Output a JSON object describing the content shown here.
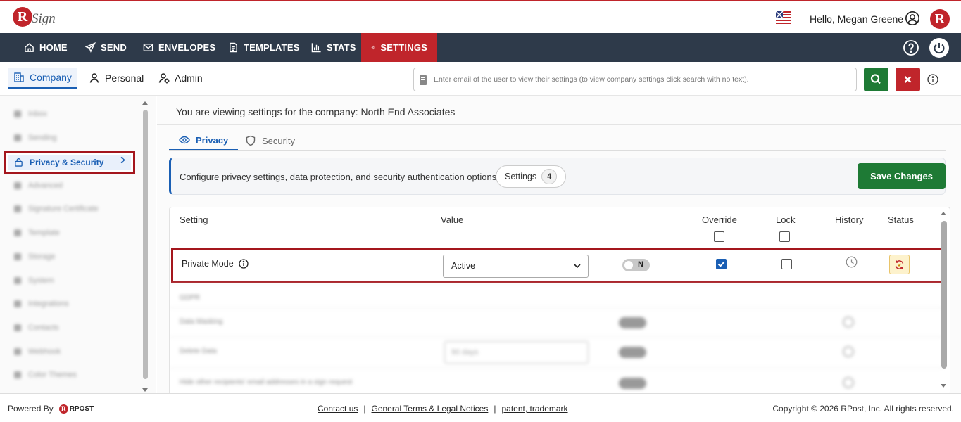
{
  "header": {
    "logo_letter": "R",
    "logo_text": "Sign",
    "greeting": "Hello, Megan Greene",
    "avatar_letter": "R",
    "flag_icon": "us-uk-flag-icon"
  },
  "nav": {
    "items": [
      {
        "label": "HOME",
        "icon": "home-icon"
      },
      {
        "label": "SEND",
        "icon": "send-icon"
      },
      {
        "label": "ENVELOPES",
        "icon": "envelope-icon"
      },
      {
        "label": "TEMPLATES",
        "icon": "template-icon"
      },
      {
        "label": "STATS",
        "icon": "stats-icon"
      },
      {
        "label": "SETTINGS",
        "icon": "gear-icon",
        "active": true
      }
    ],
    "active_color": "#c0252b",
    "bar_color": "#2e3a4a"
  },
  "subnav": {
    "tabs": [
      {
        "label": "Company",
        "active": true
      },
      {
        "label": "Personal"
      },
      {
        "label": "Admin"
      }
    ],
    "search_placeholder": "Enter email of the user to view their settings (to view company settings click search with no text)."
  },
  "sidebar": {
    "active_item": "Privacy & Security",
    "blurred_items": [
      "Inbox",
      "Sending",
      "Advanced",
      "Signature Certificate",
      "Template",
      "Storage",
      "System",
      "Integrations",
      "Contacts",
      "Webhook",
      "Color Themes"
    ]
  },
  "main": {
    "viewing_text": "You are viewing settings for the company: North End Associates",
    "tabs": [
      {
        "label": "Privacy",
        "active": true
      },
      {
        "label": "Security"
      }
    ],
    "info_text": "Configure privacy settings, data protection, and security authentication options.",
    "settings_pill_label": "Settings",
    "settings_count": "4",
    "save_label": "Save Changes"
  },
  "table": {
    "headers": {
      "setting": "Setting",
      "value": "Value",
      "override": "Override",
      "lock": "Lock",
      "history": "History",
      "status": "Status"
    },
    "highlighted_row": {
      "label": "Private Mode",
      "value": "Active",
      "toggle_label": "N",
      "override_checked": true,
      "lock_checked": false
    },
    "blurred_rows": [
      "GDPR",
      "Data Masking",
      "Delete Data",
      "Hide other recipients' email addresses in a sign request"
    ],
    "blurred_select_value": "90 days"
  },
  "footer": {
    "powered_by": "Powered By",
    "brand": "RPOST",
    "links": [
      "Contact us",
      "General Terms & Legal Notices",
      "patent, trademark"
    ],
    "separator": "|",
    "copyright": "Copyright © 2026 RPost, Inc. All rights reserved."
  }
}
